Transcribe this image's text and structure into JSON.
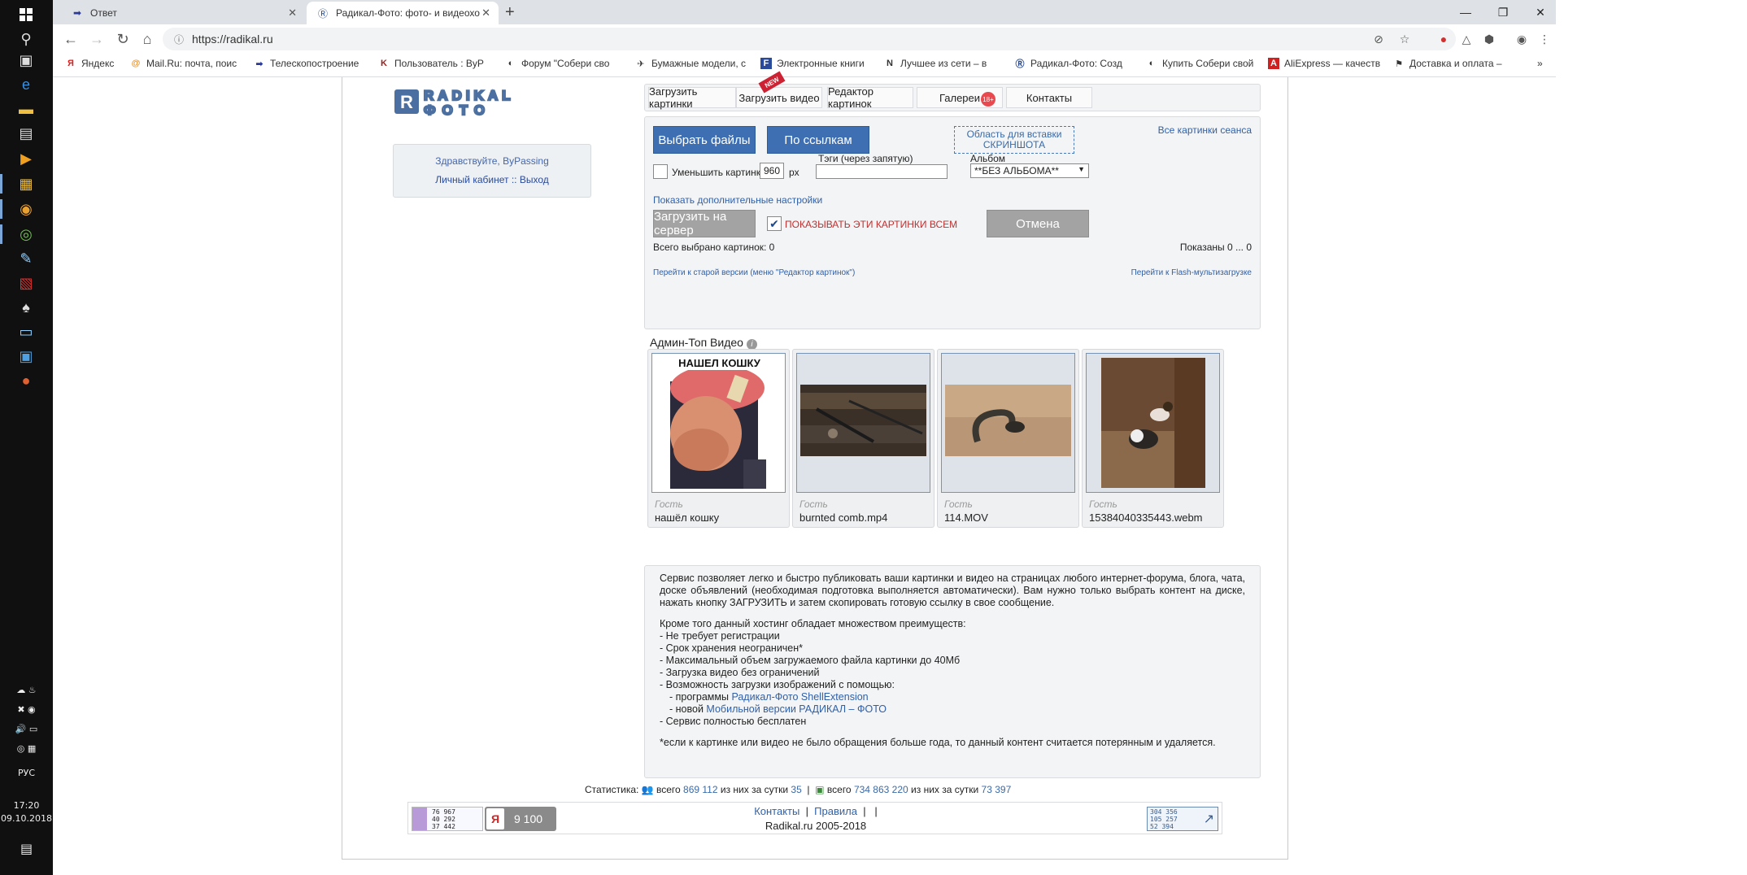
{
  "taskbar": {
    "language": "РУС",
    "time": "17:20",
    "date": "09.10.2018"
  },
  "browser": {
    "tabs": [
      {
        "title": "Ответ"
      },
      {
        "title": "Радикал-Фото: фото- и видеохо"
      }
    ],
    "url": "https://radikal.ru",
    "bookmarks": [
      "Яндекс",
      "Mail.Ru: почта, поис",
      "Телескопостроение",
      "Пользователь : ByP",
      "Форум \"Собери сво",
      "Бумажные модели, с",
      "Электронные книги",
      "Лучшее из сети – в",
      "Радикал-Фото: Созд",
      "Купить Собери свой",
      "AliExpress — качеств",
      "Доставка и оплата –"
    ]
  },
  "site": {
    "logo_text": "RADIKAL ФОТО",
    "user": {
      "greeting": "Здравствуйте, ByPassing",
      "cabinet": "Личный кабинет",
      "sep": "::",
      "logout": "Выход"
    },
    "nav": [
      {
        "label": "Загрузить картинки"
      },
      {
        "label": "Загрузить видео",
        "ribbon": "NEW"
      },
      {
        "label": "Редактор картинок"
      },
      {
        "label": "Галереи",
        "badge": "18+"
      },
      {
        "label": "Контакты"
      }
    ],
    "upload": {
      "choose_files": "Выбрать файлы",
      "by_links": "По ссылкам",
      "paste_area_line1": "Область для вставки",
      "paste_area_line2": "СКРИНШОТА",
      "all_session": "Все картинки сеанса",
      "resize_label": "Уменьшить картинки до",
      "resize_value": "960",
      "resize_unit": "px",
      "tags_label": "Тэги (через запятую)",
      "tags_value": "",
      "album_label": "Альбом",
      "album_value": "**БЕЗ АЛЬБОМА**",
      "more_settings": "Показать дополнительные настройки",
      "upload_btn": "Загрузить на сервер",
      "show_all_label": "ПОКАЗЫВАТЬ ЭТИ КАРТИНКИ ВСЕМ",
      "show_all_checked": true,
      "cancel_btn": "Отмена",
      "total_selected": "Всего выбрано картинок: 0",
      "shown": "Показаны 0 ... 0",
      "old_version": "Перейти к старой версии (меню \"Редактор картинок\")",
      "flash_upload": "Перейти к Flash-мультизагрузке"
    },
    "videos": {
      "title": "Админ-Топ Видео",
      "items": [
        {
          "author": "Гость",
          "name": "нашёл кошку",
          "caption": "НАШЕЛ КОШКУ"
        },
        {
          "author": "Гость",
          "name": "burnted comb.mp4"
        },
        {
          "author": "Гость",
          "name": "114.MOV"
        },
        {
          "author": "Гость",
          "name": "15384040335443.webm"
        }
      ]
    },
    "info": {
      "intro": "Сервис позволяет легко и быстро публиковать ваши картинки и видео на страницах любого интернет-форума, блога, чата, доске объявлений (необходимая подготовка выполняется автоматически). Вам нужно только выбрать контент на диске, нажать кнопку ЗАГРУЗИТЬ и затем скопировать готовую ссылку в свое сообщение.",
      "advantages_title": "Кроме того данный хостинг обладает множеством преимуществ:",
      "adv1": "- Не требует регистрации",
      "adv2": "- Срок хранения неограничен*",
      "adv3": "- Максимальный объем загружаемого файла картинки до 40Мб",
      "adv4": "- Загрузка видео без ограничений",
      "adv5": "- Возможность загрузки изображений с помощью:",
      "adv5a_prefix": "- программы",
      "adv5a_link": "Радикал-Фото ShellExtension",
      "adv5b_prefix": "- новой",
      "adv5b_link": "Мобильной версии РАДИКАЛ – ФОТО",
      "adv6": "- Сервис полностью бесплатен",
      "footnote": "*если к картинке или видео не было обращения больше года, то данный контент считается потерянным и удаляется."
    },
    "stats": {
      "label": "Статистика:",
      "users_all_label": "всего",
      "users_all": "869 112",
      "users_day_label": "из них за сутки",
      "users_day": "35",
      "images_all_label": "всего",
      "images_all": "734 863 220",
      "images_day_label": "из них за сутки",
      "images_day": "73 397"
    },
    "footer": {
      "contacts": "Контакты",
      "rules": "Правила",
      "copyright": "Radikal.ru 2005-2018",
      "counter1": [
        "76 967",
        "40 292",
        "37 442"
      ],
      "yandex_value": "9 100",
      "counter2": [
        "304 356",
        "105 257",
        "52 394"
      ]
    }
  }
}
